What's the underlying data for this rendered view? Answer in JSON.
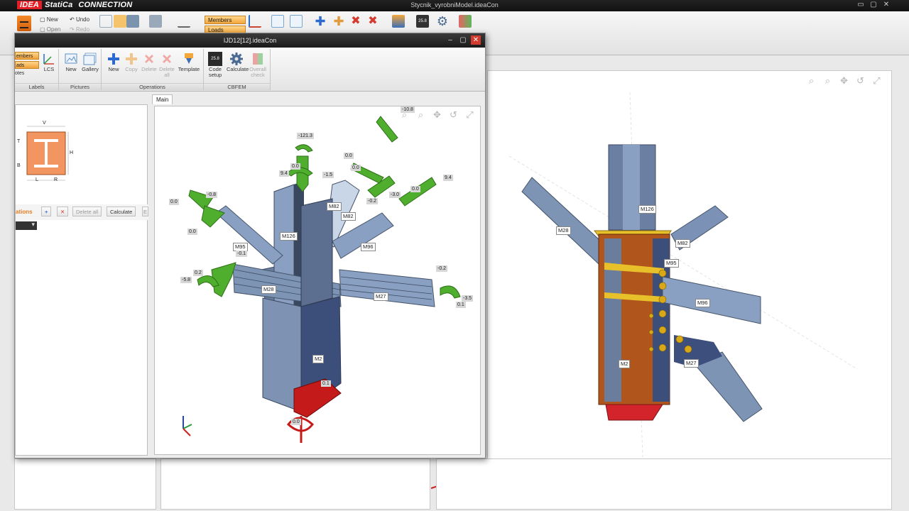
{
  "main_window": {
    "brand_box": "IDEA",
    "brand_name": "StatiCa",
    "brand_product": "CONNECTION",
    "title": "Stycnik_vyrobniModel.ideaCon",
    "controls": {
      "minimize": "▭",
      "maximize": "▢",
      "close": "✕"
    },
    "ribbon": {
      "new": "New",
      "open": "Open",
      "undo": "Undo",
      "redo": "Redo",
      "members_tag": "Members",
      "loads_tag": "Loads"
    },
    "viewport_labels": {
      "m126": "M126",
      "m28": "M28",
      "m82": "M82",
      "m95": "M95",
      "m96": "M96",
      "m2": "M2",
      "m27": "M27"
    }
  },
  "child_window": {
    "title": "IJD12[12].ideaCon",
    "controls": {
      "minimize": "–",
      "maximize": "▢",
      "close": "✕"
    },
    "ribbon": {
      "groups": {
        "labels": "Labels",
        "pictures": "Pictures",
        "operations": "Operations",
        "cbfem": "CBFEM"
      },
      "tags": {
        "members": "embers",
        "loads": "ads",
        "notes": "otes"
      },
      "lcs": "LCS",
      "pictures_new": "New",
      "gallery": "Gallery",
      "ops_new": "New",
      "copy": "Copy",
      "delete": "Delete",
      "delete_all": "Delete all",
      "template": "Template",
      "code_setup": "Code setup",
      "calculate": "Calculate",
      "overall_check": "Overall check",
      "code_badge": "25.8"
    },
    "props": {
      "section_dims": {
        "v": "V",
        "t": "T",
        "b": "B",
        "h": "H",
        "l": "L",
        "r": "R"
      },
      "operations_title": "ations",
      "add": "+",
      "remove": "✕",
      "delete_all": "Delete all",
      "calculate": "Calculate",
      "more": "E"
    },
    "tabs": [
      "Main"
    ],
    "member_labels": {
      "m126": "M126",
      "m95": "M95",
      "m28": "M28",
      "m82a": "M82",
      "m82b": "M82",
      "m96": "M96",
      "m27": "M27",
      "m2": "M2"
    },
    "load_values": {
      "v1": "-121.3",
      "v2": "0.0",
      "v3": "9.4",
      "v4": "-1.5",
      "v5": "0.0",
      "v6": "0.0",
      "v7": "-0.8",
      "v8": "0.0",
      "v9": "0.0",
      "v10": "-0.1",
      "v11": "0.2",
      "v12": "-5.8",
      "v13": "-0.2",
      "v14": "-3.0",
      "v15": "0.0",
      "v16": "9.4",
      "v17": "-0.2",
      "v18": "-3.5",
      "v19": "0.1",
      "v20": "0.1",
      "v21": "0.0",
      "v22": "-10.8"
    }
  }
}
